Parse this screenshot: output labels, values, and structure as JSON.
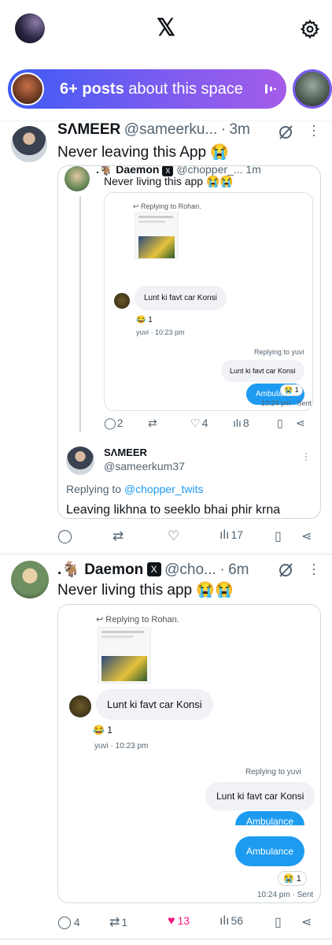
{
  "header": {
    "logo": "𝕏",
    "profile_icon": "avatar",
    "settings_icon": "gear-icon"
  },
  "spaces": {
    "count": "6+ posts",
    "rest": " about this space"
  },
  "post1": {
    "name": "SΛMEER",
    "handle": "@sameerku...",
    "dot": "·",
    "time": "3m",
    "text": "Never leaving this App 😭",
    "quoted": {
      "name": ".🐐 Daemon",
      "handle": "@chopper_...",
      "time": "1m",
      "text": "Never living this app 😭😭",
      "chat": {
        "reply_to": "Replying to Rohan.",
        "incoming": "Lunt ki favt car Konsi",
        "reaction": "😂 1",
        "meta_in": "yuvi · 10:23 pm",
        "reply_to_yuvi": "Replying to yuvi",
        "outgoing_grey": "Lunt ki favt car Konsi",
        "outgoing_blue": "Ambulance",
        "reaction2": "😭 1",
        "meta_out": "10:24 pm · Sent"
      },
      "stats": {
        "replies": "2",
        "reposts": "",
        "likes": "4",
        "views": "8"
      },
      "reply": {
        "name": "SΛMEER",
        "handle": "@sameerkum37",
        "replying_prefix": "Replying to ",
        "replying_handle": "@chopper_twits",
        "text": "Leaving likhna to seeklo bhai phir krna"
      }
    },
    "stats": {
      "replies": "",
      "reposts": "",
      "likes": "",
      "views": "17"
    }
  },
  "post2": {
    "name": ".🐐 Daemon",
    "badge": "X",
    "handle": "@cho...",
    "dot": "·",
    "time": "6m",
    "text": "Never living this app 😭😭",
    "chat": {
      "reply_to": "Replying to Rohan.",
      "incoming": "Lunt ki favt car Konsi",
      "reaction": "😂 1",
      "meta_in": "yuvi · 10:23 pm",
      "reply_to_yuvi": "Replying to yuvi",
      "outgoing_grey": "Lunt ki favt car Konsi",
      "outgoing_blue_1": "Ambulance",
      "outgoing_blue_2": "Ambulance",
      "reaction2": "😭 1",
      "meta_out": "10:24 pm · Sent"
    },
    "stats": {
      "replies": "4",
      "reposts": "1",
      "likes": "13",
      "views": "56"
    }
  },
  "colors": {
    "accent": "#1d9bf0",
    "like": "#f91880",
    "spaces_gradient_start": "#3d5bf5",
    "spaces_gradient_end": "#a45ce8"
  }
}
